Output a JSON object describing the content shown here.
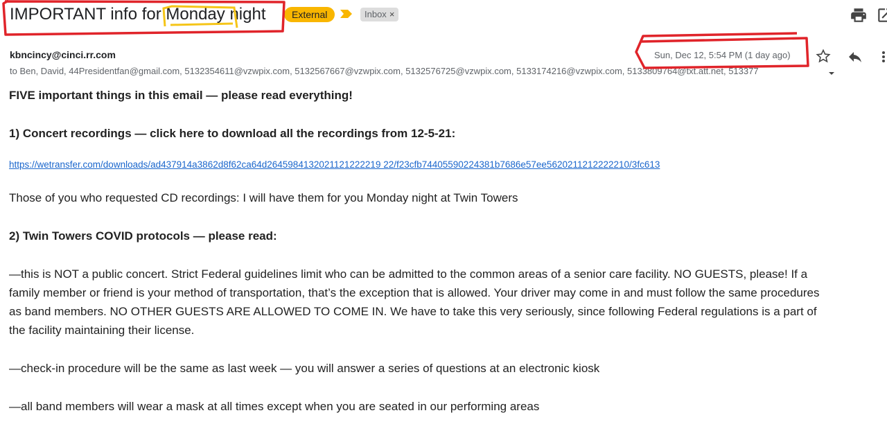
{
  "email": {
    "subject": "IMPORTANT info for Monday night",
    "labels": {
      "external": "External",
      "inbox": "Inbox",
      "inbox_close": "×"
    },
    "sender": "kbncincy@cinci.rr.com",
    "recipients": "to Ben, David, 44Presidentfan@gmail.com, 5132354611@vzwpix.com, 5132567667@vzwpix.com, 5132576725@vzwpix.com, 5133174216@vzwpix.com, 5133809764@txt.att.net, 513377",
    "date": "Sun, Dec 12, 5:54 PM (1 day ago)"
  },
  "body": {
    "intro": "FIVE important things in this email — please read everything!",
    "heading1": "1)  Concert recordings — click here to download all the recordings from 12-5-21:",
    "link": "https://wetransfer.com/downloads/ad437914a3862d8f62ca64d2645984132021121222219 22/f23cfb74405590224381b7686e57ee5620211212222210/3fc613",
    "para1": "Those of you who requested CD recordings:  I will have them for you Monday night at Twin Towers",
    "heading2": "2)  Twin Towers COVID protocols — please read:",
    "para2_line1": "—this is NOT a public concert.  Strict Federal guidelines limit who can be admitted to the common areas of a senior care facility.   NO GUESTS, please!   If a",
    "para2_line2": "family member or friend is your method of transportation, that’s the exception that is allowed.  Your driver may come in and must follow the same procedures",
    "para2_line3": "as band members.  NO OTHER GUESTS ARE ALLOWED TO COME IN.    We have to take this very seriously, since following Federal regulations is a part of",
    "para2_line4": "the facility maintaining their license.",
    "para3": "—check-in procedure will be the same as last week — you will answer a series of questions at an electronic kiosk",
    "para4": "—all band members will wear a mask at all times except when you are seated in our performing areas"
  },
  "icons": {
    "print": "print-icon",
    "new_window": "open-in-new-window-icon",
    "star": "star-icon",
    "reply": "reply-icon",
    "more": "more-vert-icon",
    "importance": "importance-marker-icon",
    "expand_recipients": "chevron-down-icon"
  },
  "colors": {
    "external_label": "#f9b600",
    "importance_marker": "#f9b600",
    "link": "#1a66cc",
    "annotation_red": "#e0242a",
    "annotation_yellow": "#f5c518"
  }
}
